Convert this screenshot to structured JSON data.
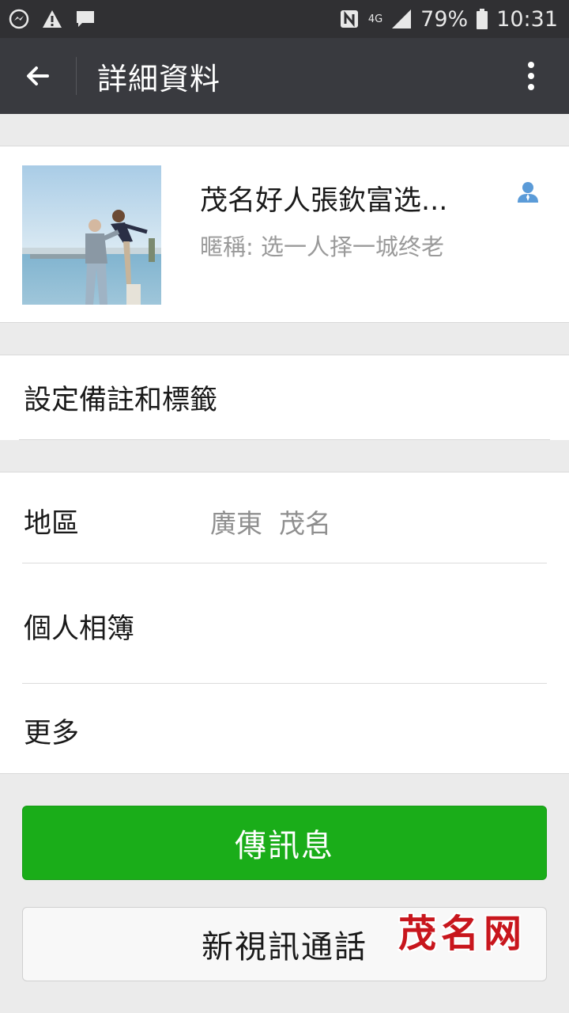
{
  "status_bar": {
    "battery": "79%",
    "time": "10:31",
    "network": "4G",
    "icons": [
      "messenger-icon",
      "warning-icon",
      "chat-icon",
      "nfc-icon",
      "signal-icon",
      "battery-icon"
    ]
  },
  "toolbar": {
    "title": "詳細資料",
    "back_icon": "arrow-left-icon",
    "more_icon": "more-vertical-icon"
  },
  "profile": {
    "name": "茂名好人張欽富选...",
    "nickname": "暱稱: 选一人择一城终老",
    "badge_icon": "contact-person-icon"
  },
  "remarks": {
    "label": "設定備註和標籤"
  },
  "info": {
    "region_label": "地區",
    "region_value": "廣東  茂名",
    "album_label": "個人相簿",
    "more_label": "更多"
  },
  "actions": {
    "message_label": "傳訊息",
    "video_call_label": "新視訊通話"
  },
  "watermark": {
    "text": "茂名网"
  },
  "colors": {
    "status_bar_bg": "#303033",
    "toolbar_bg": "#393a3f",
    "primary_green": "#1aad19",
    "page_bg": "#ebebeb",
    "watermark_red": "#c8161d"
  }
}
